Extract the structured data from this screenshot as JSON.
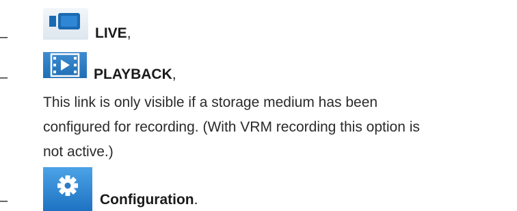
{
  "items": [
    {
      "bullet": "–",
      "label": "LIVE",
      "punct": ","
    },
    {
      "bullet": "–",
      "label": "PLAYBACK",
      "punct": ","
    },
    {
      "bullet": "–",
      "label": "Configuration",
      "punct": "."
    }
  ],
  "playback_description": [
    "This link is only visible if a storage medium has been",
    "configured for recording. (With VRM recording this option is",
    "not active.)"
  ],
  "icons": {
    "live": "video-camera-icon",
    "playback": "video-playback-icon",
    "configuration": "gear-icon"
  },
  "colors": {
    "live_icon_bg": "#e6edf3",
    "live_icon_fg": "#1a6ab3",
    "blue_icon_bg": "#2a7cc7"
  }
}
